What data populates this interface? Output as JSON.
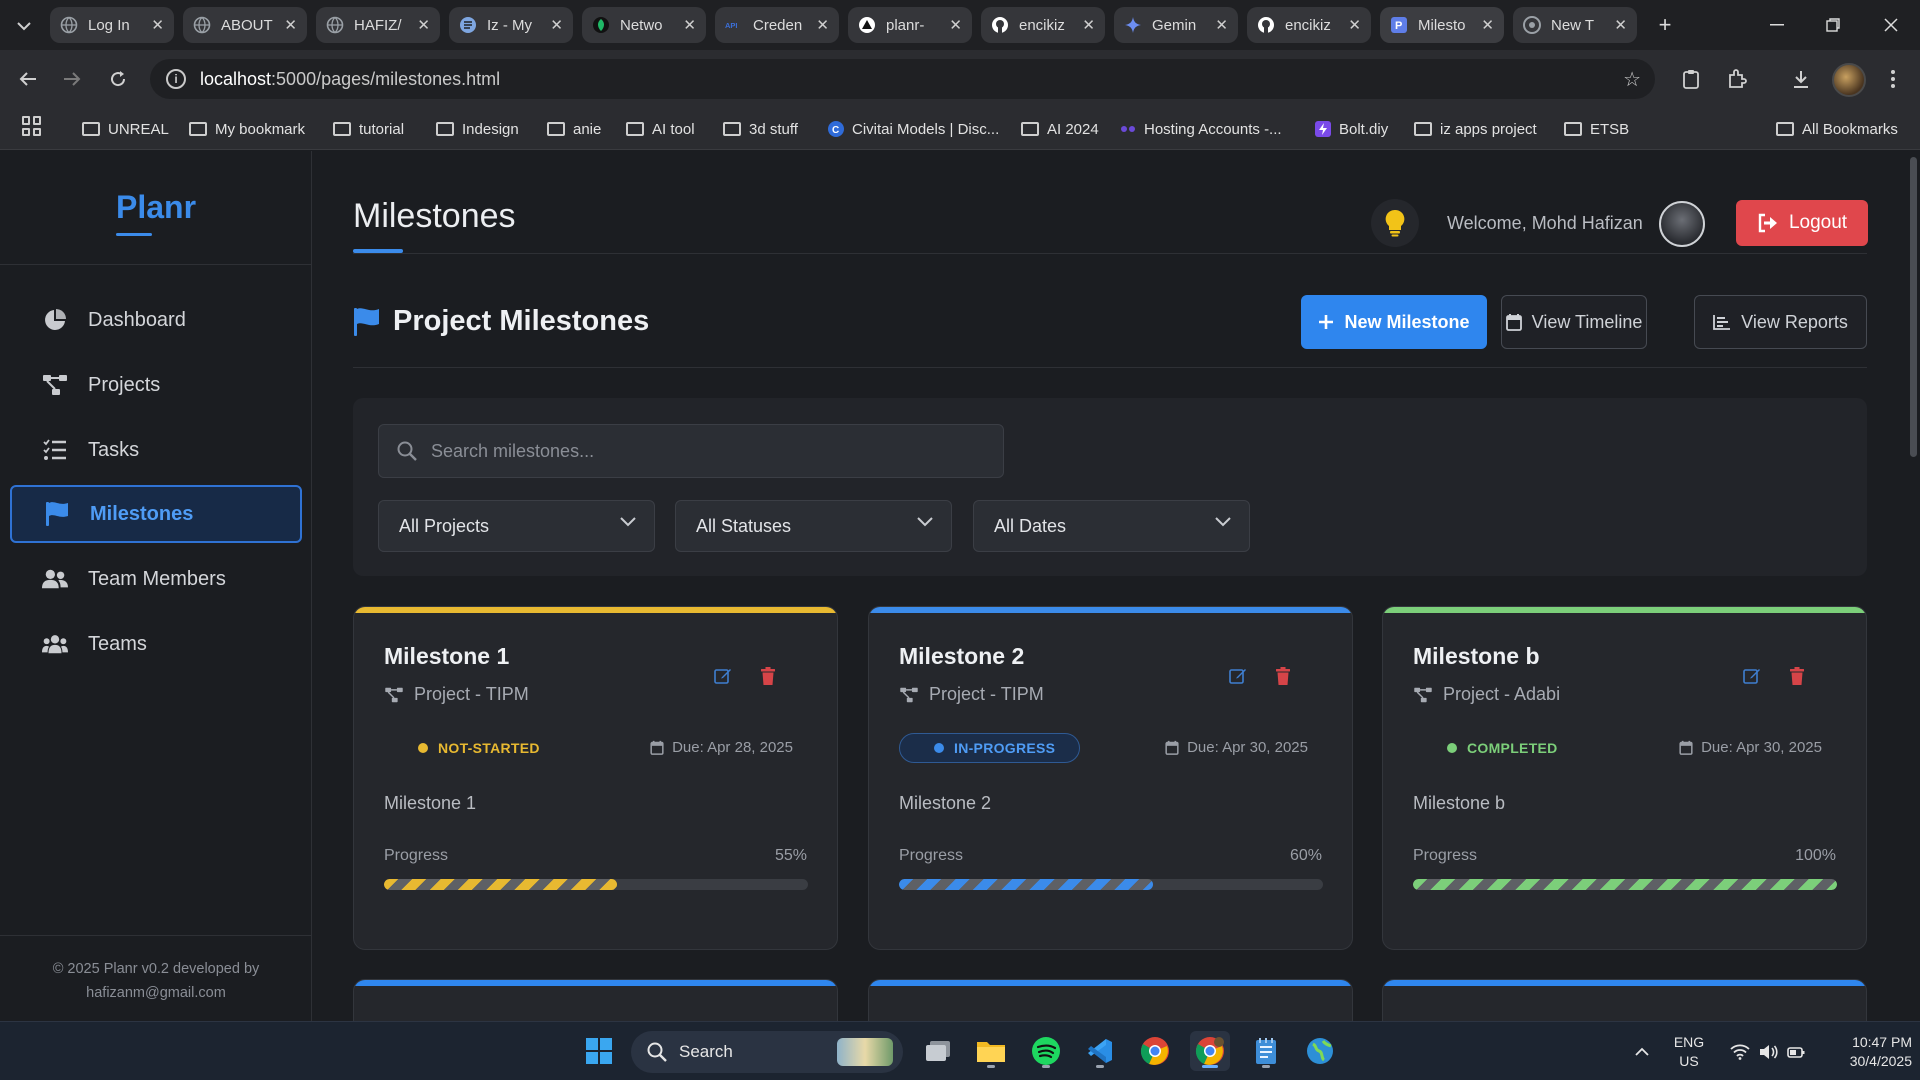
{
  "browser": {
    "tabs": [
      {
        "title": "Log In",
        "favicon": "globe-icon",
        "color": "#9aa0a6"
      },
      {
        "title": "ABOUT",
        "favicon": "globe-icon",
        "color": "#9aa0a6"
      },
      {
        "title": "HAFIZ/",
        "favicon": "globe-icon",
        "color": "#9aa0a6"
      },
      {
        "title": "Iz - My",
        "favicon": "lines-icon",
        "color": "#7ea6e0"
      },
      {
        "title": "Netwo",
        "favicon": "leaf-icon",
        "color": "#1fb866"
      },
      {
        "title": "Creden",
        "favicon": "api-icon",
        "color": "#3b6fd8"
      },
      {
        "title": "planr-",
        "favicon": "triangle-icon",
        "color": "#ffffff"
      },
      {
        "title": "encikiz",
        "favicon": "github-icon",
        "color": "#ffffff"
      },
      {
        "title": "Gemin",
        "favicon": "gemini-icon",
        "color": "#6d8ef2"
      },
      {
        "title": "encikiz",
        "favicon": "github-icon",
        "color": "#ffffff"
      },
      {
        "title": "Milesto",
        "favicon": "planr-icon",
        "color": "#5f7ee8"
      },
      {
        "title": "New T",
        "favicon": "chrome-icon",
        "color": "#9aa0a6"
      }
    ],
    "active_tab_index": 10,
    "url_host": "localhost",
    "url_path": ":5000/pages/milestones.html",
    "bookmarks": [
      {
        "label": "UNREAL",
        "icon": "folder-icon"
      },
      {
        "label": "My bookmark",
        "icon": "folder-icon"
      },
      {
        "label": "tutorial",
        "icon": "folder-icon"
      },
      {
        "label": "Indesign",
        "icon": "folder-icon"
      },
      {
        "label": "anie",
        "icon": "folder-icon"
      },
      {
        "label": "AI tool",
        "icon": "folder-icon"
      },
      {
        "label": "3d stuff",
        "icon": "folder-icon"
      },
      {
        "label": "Civitai Models | Disc...",
        "icon": "civitai-icon"
      },
      {
        "label": "AI 2024",
        "icon": "folder-icon"
      },
      {
        "label": "Hosting Accounts -...",
        "icon": "hosting-icon"
      },
      {
        "label": "Bolt.diy",
        "icon": "bolt-icon"
      },
      {
        "label": "iz apps project",
        "icon": "folder-icon"
      },
      {
        "label": "ETSB",
        "icon": "folder-icon"
      }
    ],
    "all_bookmarks_label": "All Bookmarks"
  },
  "sidebar": {
    "logo": "Planr",
    "items": [
      {
        "label": "Dashboard",
        "icon": "pie-chart-icon",
        "active": false
      },
      {
        "label": "Projects",
        "icon": "project-diagram-icon",
        "active": false
      },
      {
        "label": "Tasks",
        "icon": "task-list-icon",
        "active": false
      },
      {
        "label": "Milestones",
        "icon": "flag-icon",
        "active": true
      },
      {
        "label": "Team Members",
        "icon": "users-icon",
        "active": false
      },
      {
        "label": "Teams",
        "icon": "team-icon",
        "active": false
      }
    ],
    "footer_line1": "© 2025 Planr v0.2 developed by",
    "footer_line2": "hafizanm@gmail.com"
  },
  "header": {
    "title": "Milestones",
    "welcome": "Welcome, Mohd Hafizan",
    "logout_label": "Logout"
  },
  "section": {
    "title": "Project Milestones",
    "new_label": "New Milestone",
    "timeline_label": "View Timeline",
    "reports_label": "View Reports"
  },
  "filters": {
    "search_placeholder": "Search milestones...",
    "project_select": "All Projects",
    "status_select": "All Statuses",
    "date_select": "All Dates"
  },
  "colors": {
    "accent": "#2f86ee",
    "not_started": "#e8b931",
    "in_progress": "#3b8bea",
    "completed": "#7ccf7a",
    "danger": "#e0474c"
  },
  "milestones": [
    {
      "title": "Milestone 1",
      "project": "Project - TIPM",
      "status": "NOT-STARTED",
      "status_key": "not_started",
      "due": "Due: Apr 28, 2025",
      "description": "Milestone 1",
      "progress_label": "Progress",
      "progress_text": "55%",
      "progress": 55
    },
    {
      "title": "Milestone 2",
      "project": "Project - TIPM",
      "status": "IN-PROGRESS",
      "status_key": "in_progress",
      "due": "Due: Apr 30, 2025",
      "description": "Milestone 2",
      "progress_label": "Progress",
      "progress_text": "60%",
      "progress": 60
    },
    {
      "title": "Milestone b",
      "project": "Project - Adabi",
      "status": "COMPLETED",
      "status_key": "completed",
      "due": "Due: Apr 30, 2025",
      "description": "Milestone b",
      "progress_label": "Progress",
      "progress_text": "100%",
      "progress": 100
    }
  ],
  "taskbar": {
    "search_label": "Search",
    "lang_line1": "ENG",
    "lang_line2": "US",
    "time": "10:47 PM",
    "date": "30/4/2025"
  }
}
